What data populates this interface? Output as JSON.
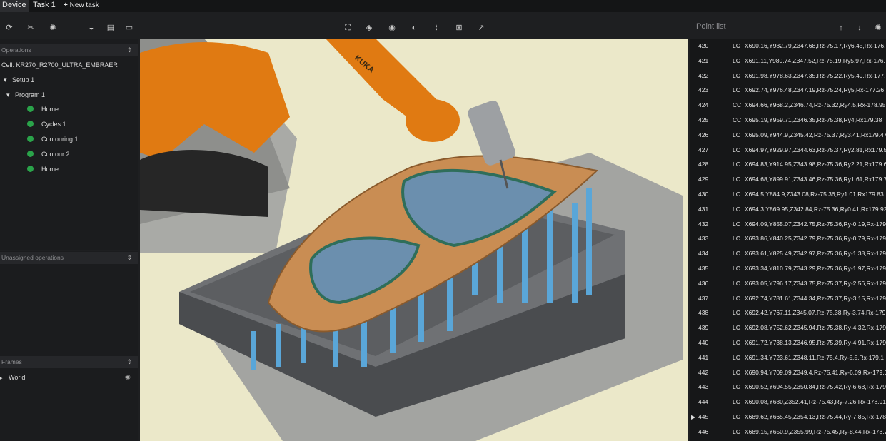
{
  "tabs": {
    "device": "Device",
    "task1": "Task 1",
    "new_task": "New task",
    "new_task_icon": "plus-icon"
  },
  "left_toolbar_icons": [
    "cube-rotate-icon",
    "tool-icon",
    "gear-icon",
    "gauge-icon",
    "document-icon",
    "monitor-icon"
  ],
  "view_toolbar_icons": [
    "fit-view-icon",
    "cube-icon",
    "eye-icon",
    "shading-icon",
    "path-icon",
    "section-icon",
    "axis-icon"
  ],
  "operations": {
    "header": "Operations",
    "sort_icon": "sort-icon",
    "cell": "Cell: KR270_R2700_ULTRA_EMBRAER",
    "setup": "Setup 1",
    "program": "Program 1",
    "items": [
      {
        "label": "Home",
        "status_color": "#2aa34a"
      },
      {
        "label": "Cycles 1",
        "status_color": "#2aa34a"
      },
      {
        "label": "Contouring 1",
        "status_color": "#2aa34a"
      },
      {
        "label": "Contour 2",
        "status_color": "#2aa34a"
      },
      {
        "label": "Home",
        "status_color": "#2aa34a"
      }
    ]
  },
  "unassigned": {
    "header": "Unassigned operations"
  },
  "frames": {
    "header": "Frames",
    "world": "World",
    "visibility_icon": "eye-icon"
  },
  "point_list": {
    "title": "Point list",
    "icons": [
      "arrow-up-icon",
      "arrow-down-icon",
      "settings-icon"
    ],
    "current_row": "445",
    "rows": [
      {
        "n": "420",
        "k": "LC",
        "v": "X690.16,Y982.79,Z347.68,Rz-75.17,Ry6.45,Rx-176."
      },
      {
        "n": "421",
        "k": "LC",
        "v": "X691.11,Y980.74,Z347.52,Rz-75.19,Ry5.97,Rx-176."
      },
      {
        "n": "422",
        "k": "LC",
        "v": "X691.98,Y978.63,Z347.35,Rz-75.22,Ry5.49,Rx-177."
      },
      {
        "n": "423",
        "k": "LC",
        "v": "X692.74,Y976.48,Z347.19,Rz-75.24,Ry5,Rx-177.26"
      },
      {
        "n": "424",
        "k": "CC",
        "v": "X694.66,Y968.2,Z346.74,Rz-75.32,Ry4.5,Rx-178.95"
      },
      {
        "n": "425",
        "k": "CC",
        "v": "X695.19,Y959.71,Z346.35,Rz-75.38,Ry4,Rx179.38"
      },
      {
        "n": "426",
        "k": "LC",
        "v": "X695.09,Y944.9,Z345.42,Rz-75.37,Ry3.41,Rx179.47"
      },
      {
        "n": "427",
        "k": "LC",
        "v": "X694.97,Y929.97,Z344.63,Rz-75.37,Ry2.81,Rx179.5"
      },
      {
        "n": "428",
        "k": "LC",
        "v": "X694.83,Y914.95,Z343.98,Rz-75.36,Ry2.21,Rx179.6"
      },
      {
        "n": "429",
        "k": "LC",
        "v": "X694.68,Y899.91,Z343.46,Rz-75.36,Ry1.61,Rx179.7"
      },
      {
        "n": "430",
        "k": "LC",
        "v": "X694.5,Y884.9,Z343.08,Rz-75.36,Ry1.01,Rx179.83"
      },
      {
        "n": "431",
        "k": "LC",
        "v": "X694.3,Y869.95,Z342.84,Rz-75.36,Ry0.41,Rx179.92"
      },
      {
        "n": "432",
        "k": "LC",
        "v": "X694.09,Y855.07,Z342.75,Rz-75.36,Ry-0.19,Rx-179"
      },
      {
        "n": "433",
        "k": "LC",
        "v": "X693.86,Y840.25,Z342.79,Rz-75.36,Ry-0.79,Rx-179"
      },
      {
        "n": "434",
        "k": "LC",
        "v": "X693.61,Y825.49,Z342.97,Rz-75.36,Ry-1.38,Rx-179"
      },
      {
        "n": "435",
        "k": "LC",
        "v": "X693.34,Y810.79,Z343.29,Rz-75.36,Ry-1.97,Rx-179"
      },
      {
        "n": "436",
        "k": "LC",
        "v": "X693.05,Y796.17,Z343.75,Rz-75.37,Ry-2.56,Rx-179"
      },
      {
        "n": "437",
        "k": "LC",
        "v": "X692.74,Y781.61,Z344.34,Rz-75.37,Ry-3.15,Rx-179"
      },
      {
        "n": "438",
        "k": "LC",
        "v": "X692.42,Y767.11,Z345.07,Rz-75.38,Ry-3.74,Rx-179"
      },
      {
        "n": "439",
        "k": "LC",
        "v": "X692.08,Y752.62,Z345.94,Rz-75.38,Ry-4.32,Rx-179"
      },
      {
        "n": "440",
        "k": "LC",
        "v": "X691.72,Y738.13,Z346.95,Rz-75.39,Ry-4.91,Rx-179"
      },
      {
        "n": "441",
        "k": "LC",
        "v": "X691.34,Y723.61,Z348.11,Rz-75.4,Ry-5.5,Rx-179.1"
      },
      {
        "n": "442",
        "k": "LC",
        "v": "X690.94,Y709.09,Z349.4,Rz-75.41,Ry-6.09,Rx-179.0"
      },
      {
        "n": "443",
        "k": "LC",
        "v": "X690.52,Y694.55,Z350.84,Rz-75.42,Ry-6.68,Rx-179"
      },
      {
        "n": "444",
        "k": "LC",
        "v": "X690.08,Y680,Z352.41,Rz-75.43,Ry-7.26,Rx-178.91"
      },
      {
        "n": "445",
        "k": "LC",
        "v": "X689.62,Y665.45,Z354.13,Rz-75.44,Ry-7.85,Rx-178"
      },
      {
        "n": "446",
        "k": "LC",
        "v": "X689.15,Y650.9,Z355.99,Rz-75.45,Ry-8.44,Rx-178.7"
      }
    ]
  },
  "viewport": {
    "robot_brand": "KUKA",
    "robot_color": "#e07a12",
    "part_color": "#c98d53",
    "bg_color": "#ebe8c9"
  }
}
